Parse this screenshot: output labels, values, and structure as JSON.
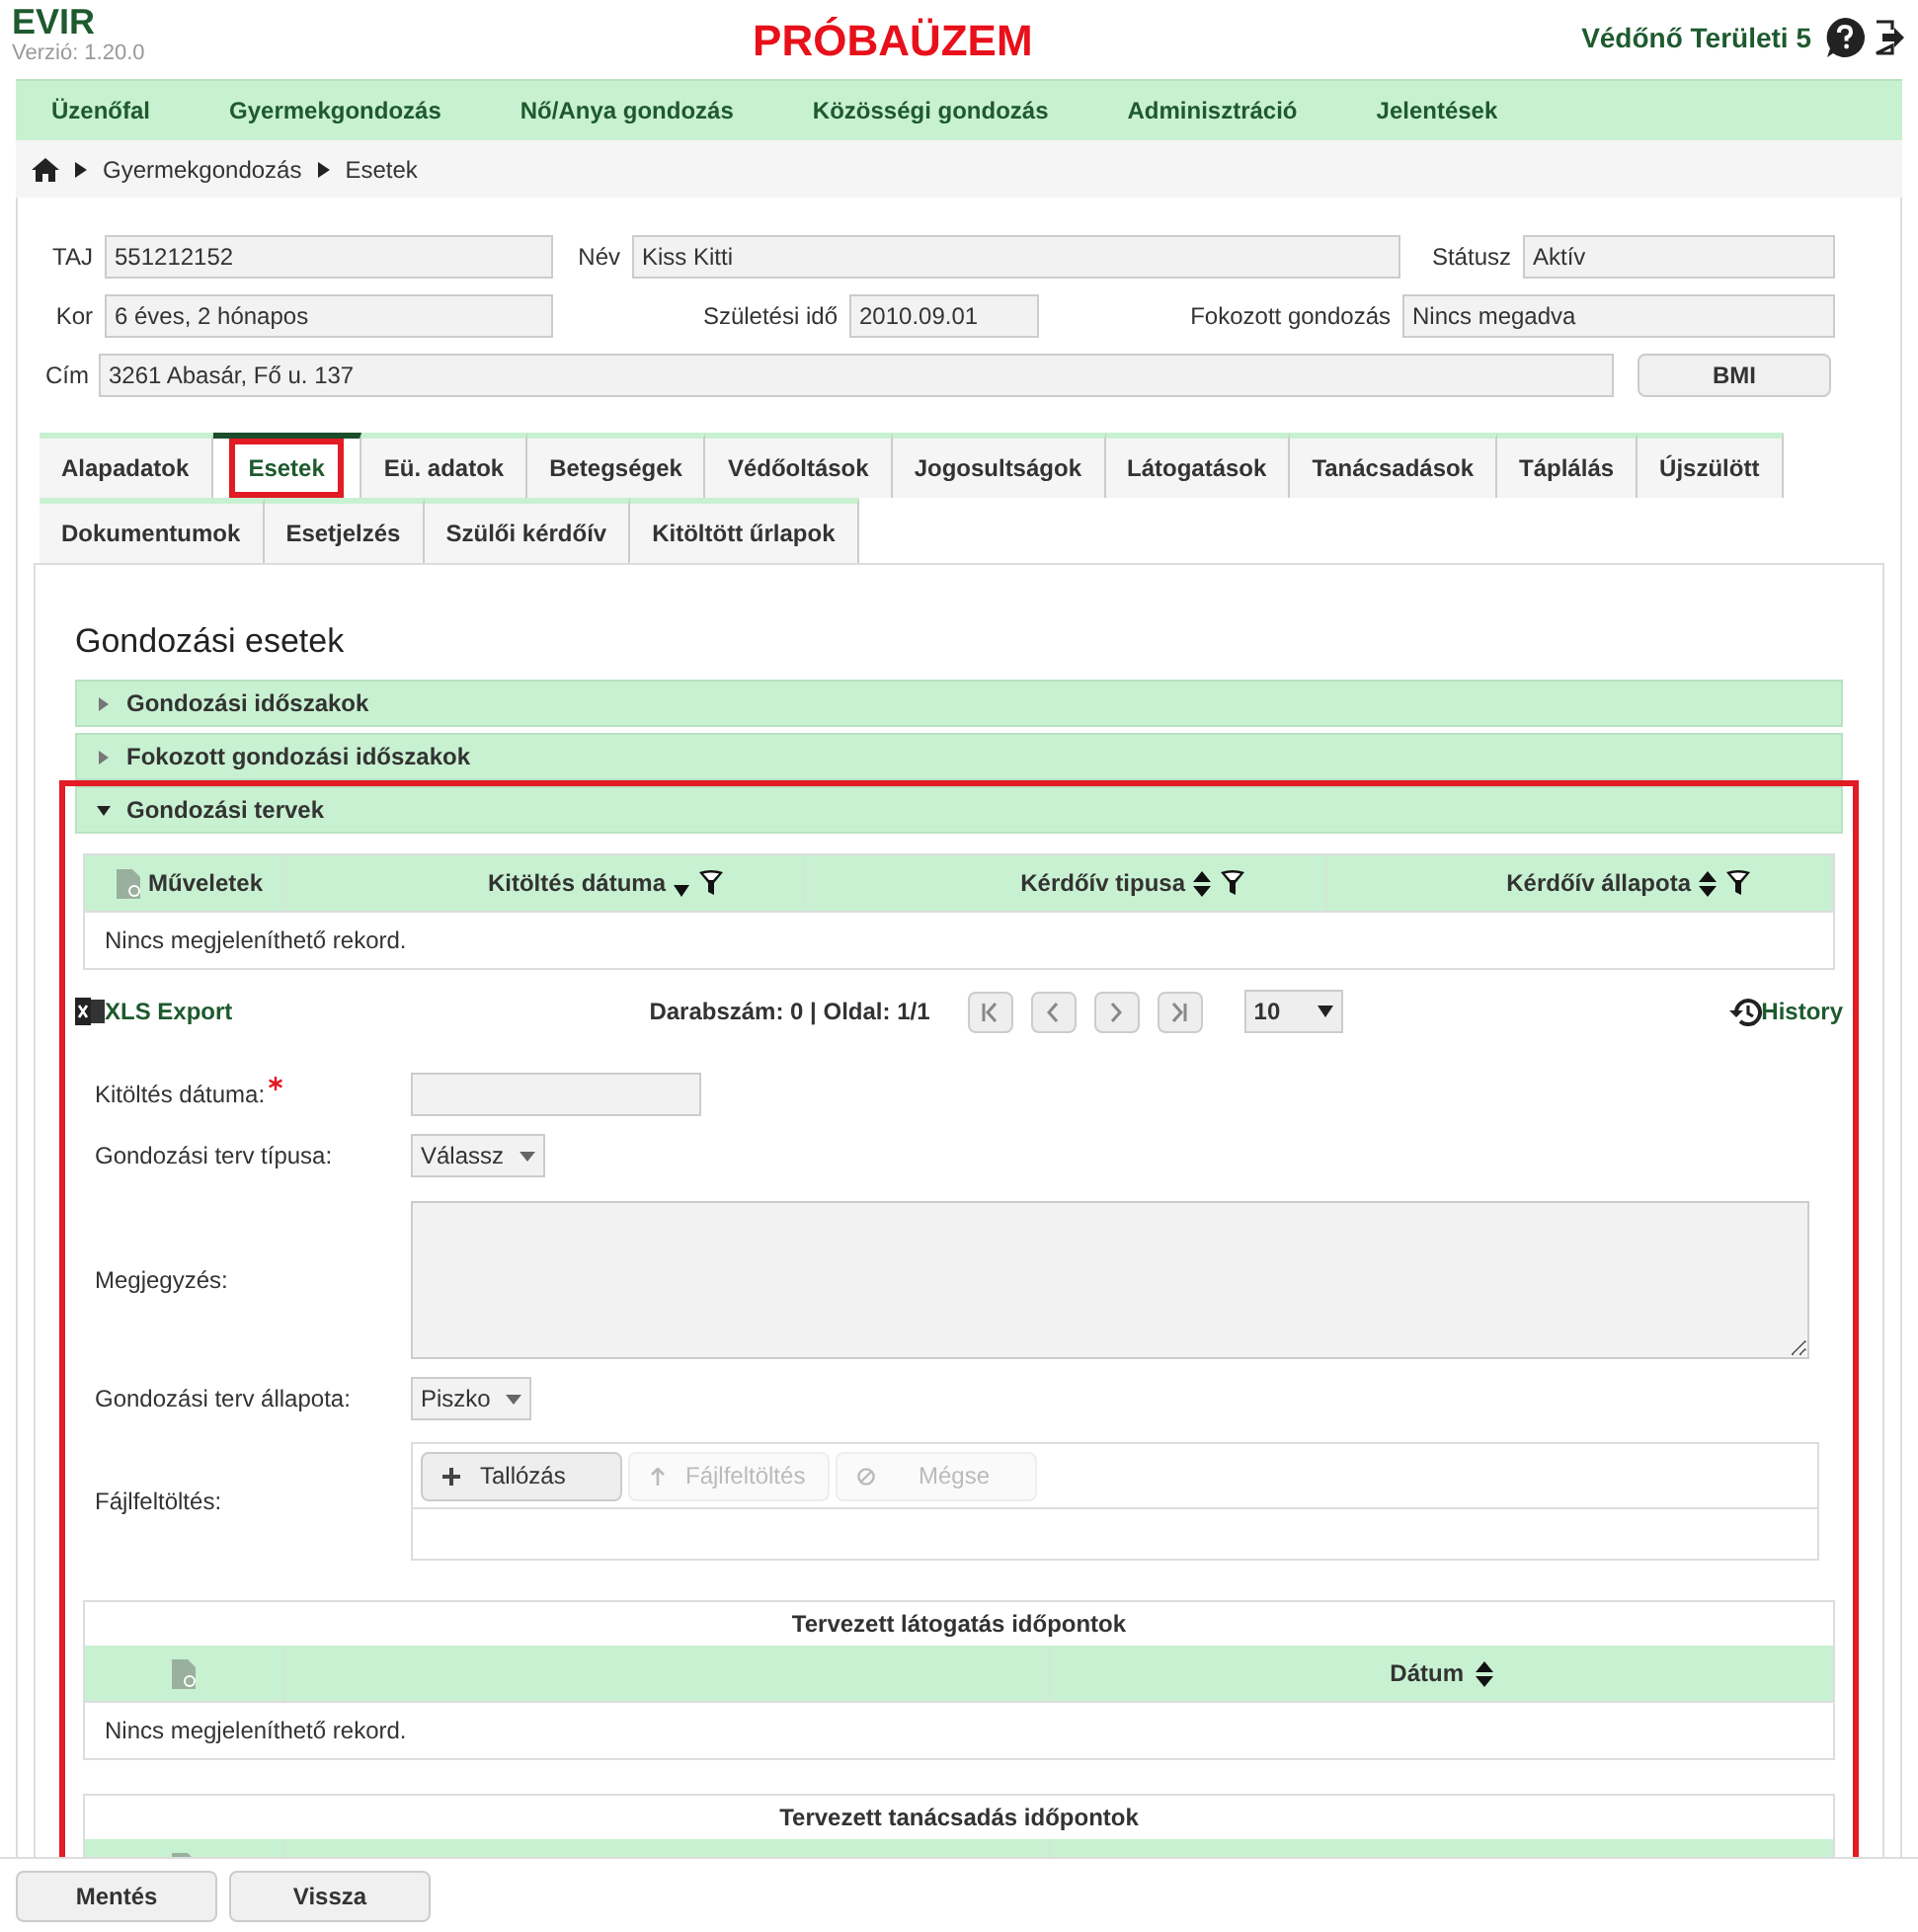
{
  "app": {
    "name": "EVIR",
    "version": "Verzió: 1.20.0",
    "banner": "PRÓBAÜZEM",
    "user": "Védőnő Területi 5"
  },
  "nav": [
    {
      "label": "Üzenőfal"
    },
    {
      "label": "Gyermekgondozás"
    },
    {
      "label": "Nő/Anya gondozás"
    },
    {
      "label": "Közösségi gondozás"
    },
    {
      "label": "Adminisztráció"
    },
    {
      "label": "Jelentések"
    }
  ],
  "breadcrumb": [
    "Gyermekgondozás",
    "Esetek"
  ],
  "patient": {
    "rows": [
      [
        {
          "label": "TAJ",
          "value": "551212152"
        },
        {
          "label": "Név",
          "value": "Kiss Kitti"
        },
        {
          "label": "Státusz",
          "value": "Aktív"
        }
      ],
      [
        {
          "label": "Kor",
          "value": "6 éves, 2 hónapos"
        },
        {
          "label": "Születési idő",
          "value": "2010.09.01"
        },
        {
          "label": "Fokozott gondozás",
          "value": "Nincs megadva"
        }
      ],
      [
        {
          "label": "Cím",
          "value": "3261 Abasár, Fő u. 137"
        }
      ]
    ],
    "bmi_button": "BMI"
  },
  "tabs": [
    [
      {
        "label": "Alapadatok",
        "selected": false
      },
      {
        "label": "Esetek",
        "selected": true
      },
      {
        "label": "Eü. adatok",
        "selected": false
      },
      {
        "label": "Betegségek",
        "selected": false
      },
      {
        "label": "Védőoltások",
        "selected": false
      },
      {
        "label": "Jogosultságok",
        "selected": false
      },
      {
        "label": "Látogatások",
        "selected": false
      },
      {
        "label": "Tanácsadások",
        "selected": false
      },
      {
        "label": "Táplálás",
        "selected": false
      },
      {
        "label": "Újszülött",
        "selected": false
      }
    ],
    [
      {
        "label": "Dokumentumok",
        "selected": false
      },
      {
        "label": "Esetjelzés",
        "selected": false
      },
      {
        "label": "Szülői kérdőív",
        "selected": false
      },
      {
        "label": "Kitöltött űrlapok",
        "selected": false
      }
    ]
  ],
  "panel": {
    "title": "Gondozási esetek",
    "sections": [
      {
        "title": "Gondozási időszakok",
        "expanded": false,
        "highlighted": false
      },
      {
        "title": "Fokozott gondozási időszakok",
        "expanded": false,
        "highlighted": false
      },
      {
        "title": "Gondozási tervek",
        "expanded": true,
        "highlighted": true
      }
    ],
    "grid": {
      "columns": [
        {
          "label": "Műveletek"
        },
        {
          "label": "Kitöltés dátuma",
          "sortable": true,
          "sorted": true,
          "filter": true
        },
        {
          "label": "Kérdőív tipusa",
          "sortable": true,
          "sorted": false,
          "filter": true
        },
        {
          "label": "Kérdőív állapota",
          "sortable": true,
          "sorted": false,
          "filter": true
        }
      ],
      "empty": "Nincs megjeleníthető rekord."
    },
    "pager": {
      "export": "XLS Export",
      "count": "Darabszám: 0 | Oldal: 1/1",
      "page_size": "10",
      "history": "History"
    },
    "form": [
      {
        "kind": "date",
        "label": "Kitöltés dátuma:",
        "required": true
      },
      {
        "kind": "select",
        "label": "Gondozási terv típusa:",
        "value": "Válassz"
      },
      {
        "kind": "textarea",
        "label": "Megjegyzés:"
      },
      {
        "kind": "select",
        "label": "Gondozási terv állapota:",
        "value": "Piszko"
      },
      {
        "kind": "upload",
        "label": "Fájlfeltöltés:",
        "buttons": [
          {
            "kind": "add",
            "label": "Tallózás",
            "disabled": false
          },
          {
            "kind": "upload",
            "label": "Fájlfeltöltés",
            "disabled": true
          },
          {
            "kind": "cancel",
            "label": "Mégse",
            "disabled": true
          }
        ]
      }
    ],
    "subtables": [
      {
        "title": "Tervezett látogatás időpontok",
        "column": "Dátum",
        "empty": "Nincs megjeleníthető rekord."
      },
      {
        "title": "Tervezett tanácsadás időpontok"
      }
    ]
  },
  "footer_buttons": [
    "Mentés",
    "Vissza"
  ]
}
